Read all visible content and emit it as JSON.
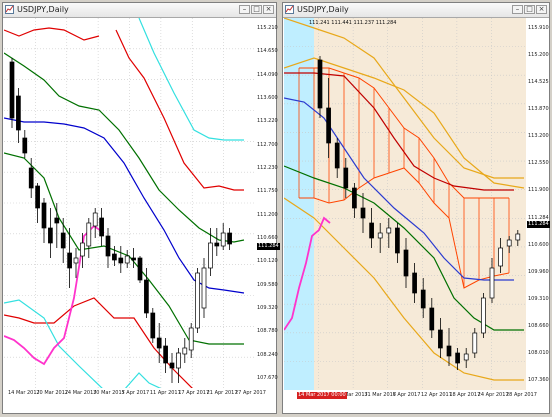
{
  "left_window": {
    "title": "USDJPY,Daily",
    "info": "",
    "price_tag": "111.284",
    "y_labels": [
      "115.210",
      "114.650",
      "114.090",
      "113.600",
      "113.220",
      "112.700",
      "112.230",
      "111.750",
      "111.200",
      "110.660",
      "110.120",
      "109.580",
      "109.320",
      "108.780",
      "108.240",
      "107.670"
    ],
    "x_labels": [
      "14 Mar 2017",
      "20 Mar 2017",
      "24 Mar 2017",
      "30 Mar 2017",
      "5 Apr 2017",
      "11 Apr 2017",
      "17 Apr 2017",
      "21 Apr 2017",
      "27 Apr 2017"
    ],
    "colors": {
      "bull": "#ffffff",
      "bear": "#000000",
      "upper2": "#e00000",
      "upper1": "#007000",
      "mid": "#0000cc",
      "outer": "#33e0e0",
      "lagging": "#ff33cc"
    }
  },
  "right_window": {
    "title": "USDJPY,Daily",
    "info": "111.241 111.441 111.237 111.284",
    "price_tag": "111.284",
    "date_marker": "14 Mar 2017 00:00",
    "y_labels": [
      "115.910",
      "115.200",
      "114.525",
      "113.870",
      "113.200",
      "112.550",
      "111.900",
      "111.284",
      "110.600",
      "109.960",
      "109.310",
      "108.660",
      "108.010",
      "107.360"
    ],
    "x_labels": [
      "27 Mar 2017",
      "31 Mar 2017",
      "6 Apr 2017",
      "12 Apr 2017",
      "18 Apr 2017",
      "24 Apr 2017",
      "28 Apr 2017"
    ],
    "colors": {
      "cloud_fill": "#f6ead8",
      "cloud_line": "#ff4400",
      "kijun": "#c00000",
      "tenkan": "#2b3bd0",
      "channel": "#e8a81a",
      "ma": "#007000",
      "lagging": "#ff33cc",
      "highlight": "#bfeeff"
    }
  }
}
